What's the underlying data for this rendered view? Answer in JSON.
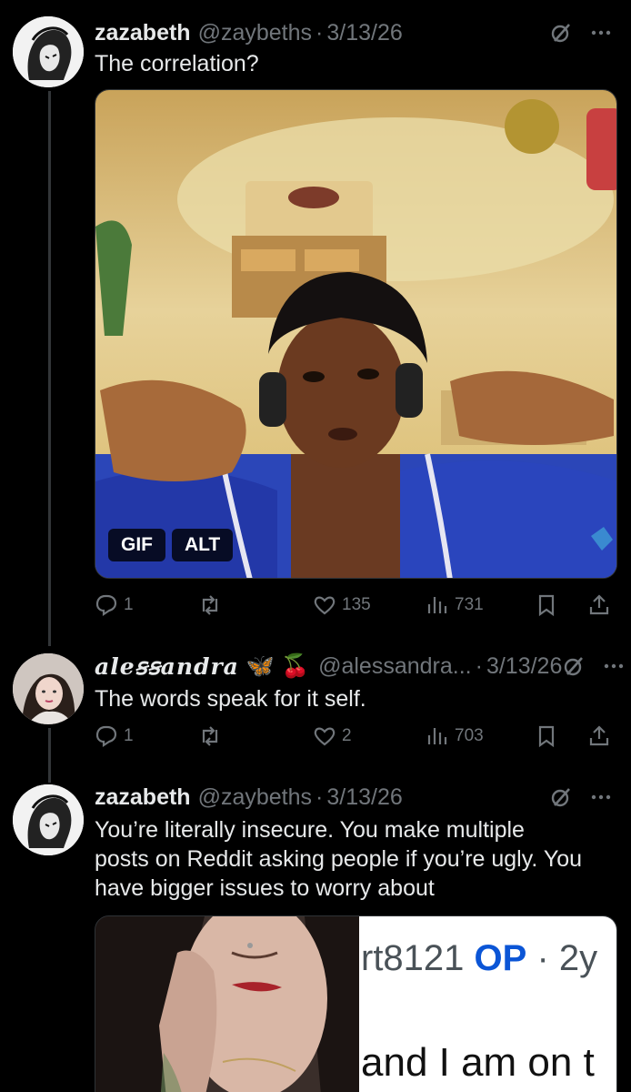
{
  "posts": [
    {
      "name": "zazabeth",
      "handle": "@zaybeths",
      "separator": "·",
      "date": "3/13/26",
      "text": "The correlation?",
      "media": {
        "badges": [
          "GIF",
          "ALT"
        ]
      },
      "actions": {
        "replies": "1",
        "reposts": "",
        "likes": "135",
        "views": "731"
      }
    },
    {
      "name": "aleꞩꞩandra",
      "name_emoji": "🦋 🍒",
      "handle": "@alessandra...",
      "separator": "·",
      "date": "3/13/26",
      "text": "The words speak for it self.",
      "actions": {
        "replies": "1",
        "reposts": "",
        "likes": "2",
        "views": "703"
      }
    },
    {
      "name": "zazabeth",
      "handle": "@zaybeths",
      "separator": "·",
      "date": "3/13/26",
      "text_lines": [
        "You’re literally insecure. You make multiple",
        "posts on Reddit asking people if you’re ugly. You",
        "have bigger issues to worry about"
      ],
      "media": {
        "reddit": {
          "user_fragment": "rt8121",
          "op_label": "OP",
          "separator": "·",
          "age": "2y",
          "body_fragment": "and I am on t"
        }
      }
    }
  ],
  "colors": {
    "background": "#000000",
    "text": "#e7e9ea",
    "muted": "#71767b",
    "divider": "#333639"
  },
  "icons": [
    "grok-icon",
    "more-icon",
    "reply-icon",
    "repost-icon",
    "like-icon",
    "views-icon",
    "bookmark-icon",
    "share-icon"
  ]
}
